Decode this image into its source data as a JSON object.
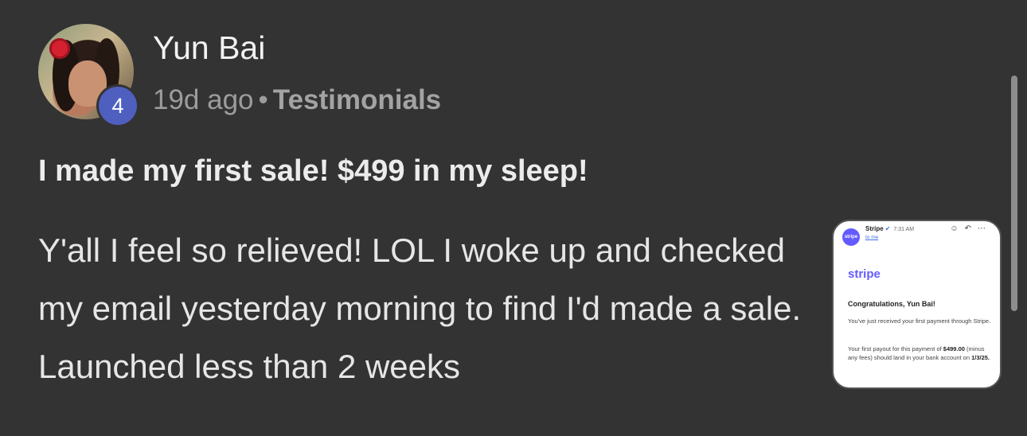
{
  "post": {
    "author": "Yun Bai",
    "level": "4",
    "time_ago": "19d ago",
    "separator": "•",
    "category": "Testimonials",
    "title": "I made my first sale! $499 in my sleep!",
    "body": "Y'all I feel so relieved! LOL I woke up and checked my email yesterday morning to find I'd made a sale. Launched less than 2 weeks"
  },
  "attachment": {
    "logo_text": "stripe",
    "sender": "Stripe",
    "time": "7:31 AM",
    "to": "to me",
    "brand": "stripe",
    "congrats": "Congratulations, Yun Bai!",
    "line1": "You've just received your first payment through Stripe.",
    "line2_a": "Your first payout for this payment of",
    "amount": "$499.00",
    "line2_b": "(minus any fees) should land in your bank account on",
    "date": "1/3/25."
  },
  "colors": {
    "background": "#333333",
    "badge": "#4f5fbf",
    "stripe_brand": "#635bff"
  },
  "icons": [
    "verified-check-icon",
    "emoji-icon",
    "reply-icon",
    "more-icon"
  ]
}
